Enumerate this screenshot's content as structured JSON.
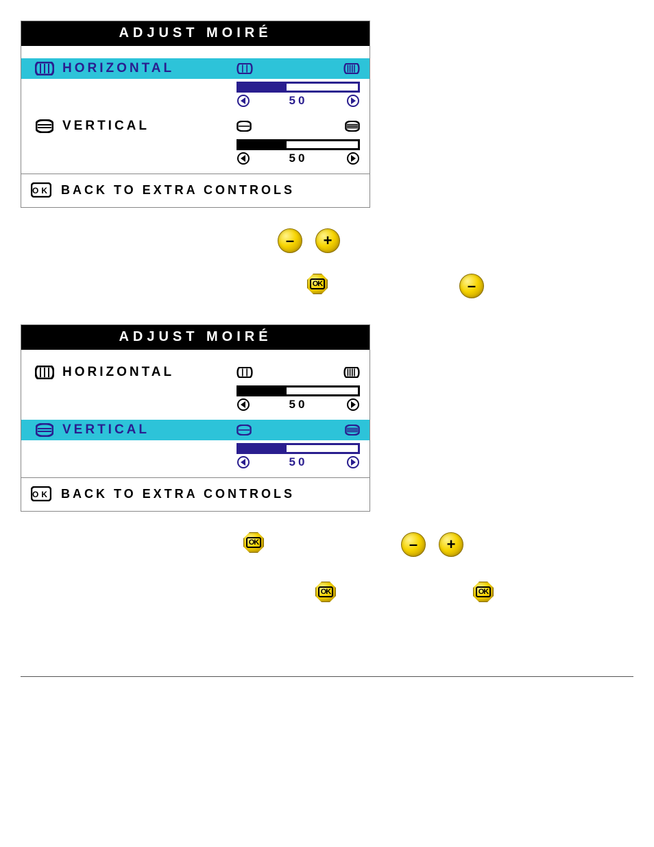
{
  "panelA": {
    "title": "ADJUST MOIRÉ",
    "horizontal": {
      "label": "HORIZONTAL",
      "value": "50",
      "fill": 40,
      "selected": true
    },
    "vertical": {
      "label": "VERTICAL",
      "value": "50",
      "fill": 40,
      "selected": false
    },
    "back": "BACK TO EXTRA CONTROLS"
  },
  "panelB": {
    "title": "ADJUST MOIRÉ",
    "horizontal": {
      "label": "HORIZONTAL",
      "value": "50",
      "fill": 40,
      "selected": false
    },
    "vertical": {
      "label": "VERTICAL",
      "value": "50",
      "fill": 40,
      "selected": true
    },
    "back": "BACK TO EXTRA CONTROLS"
  },
  "buttons": {
    "minus": "–",
    "plus": "+",
    "ok": "OK"
  }
}
